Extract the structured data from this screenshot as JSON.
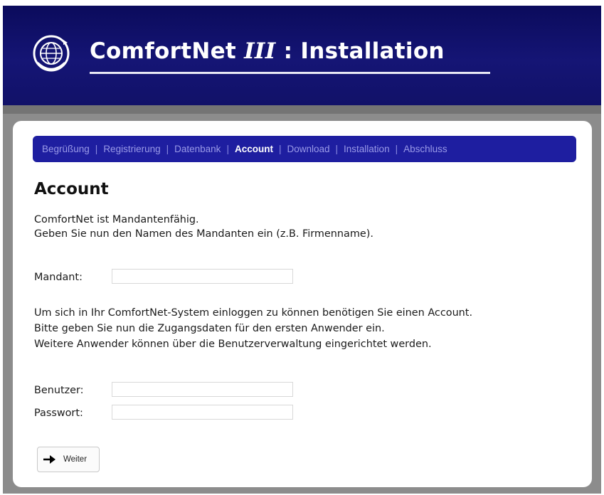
{
  "header": {
    "title_part1": "ComfortNet ",
    "title_italic": "III",
    "title_part2": " : Installation",
    "logo_icon": "globe-icon"
  },
  "nav": {
    "items": [
      {
        "label": "Begrüßung",
        "active": false
      },
      {
        "label": "Registrierung",
        "active": false
      },
      {
        "label": "Datenbank",
        "active": false
      },
      {
        "label": "Account",
        "active": true
      },
      {
        "label": "Download",
        "active": false
      },
      {
        "label": "Installation",
        "active": false
      },
      {
        "label": "Abschluss",
        "active": false
      }
    ],
    "separator": "|"
  },
  "main": {
    "heading": "Account",
    "intro_line1": "ComfortNet ist Mandantenfähig.",
    "intro_line2": "Geben Sie nun den Namen des Mandanten ein (z.B. Firmenname).",
    "mandant_label": "Mandant:",
    "mandant_value": "",
    "account_line1": "Um sich in Ihr ComfortNet-System einloggen zu können benötigen Sie einen Account.",
    "account_line2": "Bitte geben Sie nun die Zugangsdaten für den ersten Anwender ein.",
    "account_line3": "Weitere Anwender können über die Benutzerverwaltung eingerichtet werden.",
    "user_label": "Benutzer:",
    "user_value": "",
    "password_label": "Passwort:",
    "password_value": "",
    "next_button_label": "Weiter",
    "next_button_icon": "arrow-right-icon"
  },
  "colors": {
    "header_bg": "#12126a",
    "nav_bg": "#1e1ea0",
    "frame_bg": "#8c8c8c"
  }
}
